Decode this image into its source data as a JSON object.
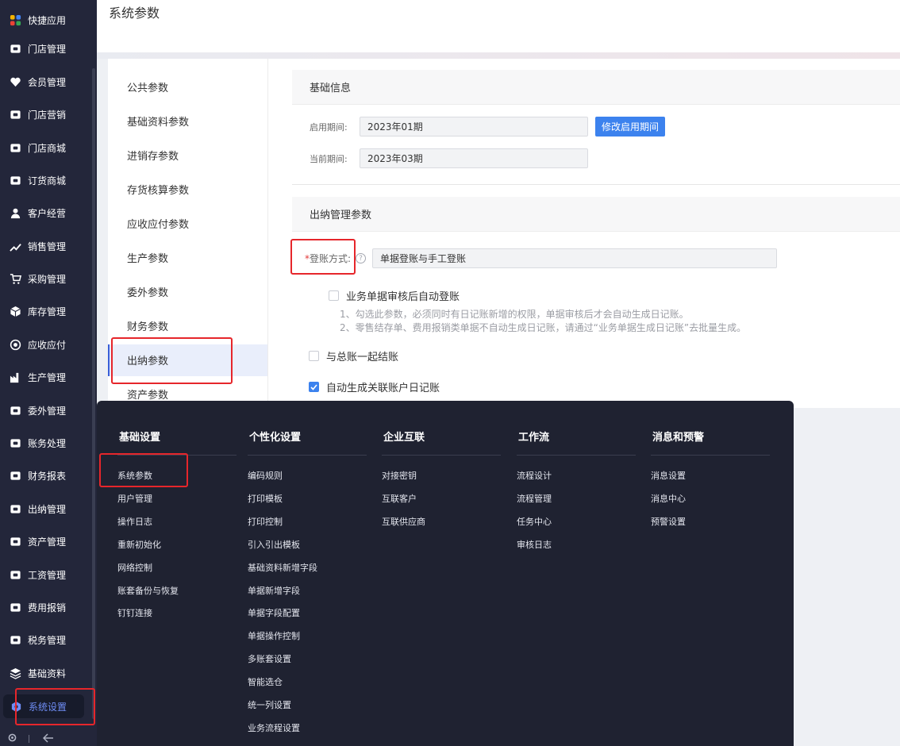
{
  "header": {
    "title": "系统参数"
  },
  "nav": {
    "items": [
      {
        "label": "快捷应用",
        "icon": "grid-apps-icon"
      },
      {
        "label": "门店管理",
        "icon": "store-icon"
      },
      {
        "label": "会员管理",
        "icon": "heart-icon"
      },
      {
        "label": "门店营销",
        "icon": "marketing-icon"
      },
      {
        "label": "门店商城",
        "icon": "mall-icon"
      },
      {
        "label": "订货商城",
        "icon": "bag-icon"
      },
      {
        "label": "客户经营",
        "icon": "user-icon"
      },
      {
        "label": "销售管理",
        "icon": "sales-icon"
      },
      {
        "label": "采购管理",
        "icon": "cart-icon"
      },
      {
        "label": "库存管理",
        "icon": "box-icon"
      },
      {
        "label": "应收应付",
        "icon": "target-icon"
      },
      {
        "label": "生产管理",
        "icon": "factory-icon"
      },
      {
        "label": "委外管理",
        "icon": "outsource-icon"
      },
      {
        "label": "账务处理",
        "icon": "ledger-icon"
      },
      {
        "label": "财务报表",
        "icon": "report-icon"
      },
      {
        "label": "出纳管理",
        "icon": "cashier-icon"
      },
      {
        "label": "资产管理",
        "icon": "asset-icon"
      },
      {
        "label": "工资管理",
        "icon": "salary-icon"
      },
      {
        "label": "费用报销",
        "icon": "expense-icon"
      },
      {
        "label": "税务管理",
        "icon": "tax-icon"
      },
      {
        "label": "基础资料",
        "icon": "layers-icon"
      },
      {
        "label": "系统设置",
        "icon": "settings-hex-icon"
      }
    ],
    "active_index": 21
  },
  "param_list": {
    "items": [
      "公共参数",
      "基础资料参数",
      "进销存参数",
      "存货核算参数",
      "应收应付参数",
      "生产参数",
      "委外参数",
      "财务参数",
      "出纳参数",
      "资产参数"
    ],
    "active_index": 8
  },
  "basic_info": {
    "title": "基础信息",
    "start_period_label": "启用期间:",
    "start_period_value": "2023年01期",
    "modify_button": "修改启用期间",
    "current_period_label": "当前期间:",
    "current_period_value": "2023年03期"
  },
  "cashier": {
    "title": "出纳管理参数",
    "required_mark": "*",
    "posting_label": "登账方式:",
    "help_mark": "?",
    "posting_value": "单据登账与手工登账",
    "auto_post_label": "业务单据审核后自动登账",
    "auto_post_checked": false,
    "note1": "1、勾选此参数，必须同时有日记账新增的权限，单据审核后才会自动生成日记账。",
    "note2": "2、零售结存单、费用报销类单据不自动生成日记账，请通过“业务单据生成日记账”去批量生成。",
    "close_with_gl_label": "与总账一起结账",
    "close_with_gl_checked": false,
    "auto_journal_label": "自动生成关联账户日记账",
    "auto_journal_checked": true
  },
  "megamenu": {
    "columns": [
      {
        "title": "基础设置",
        "items": [
          "系统参数",
          "用户管理",
          "操作日志",
          "重新初始化",
          "网络控制",
          "账套备份与恢复",
          "钉钉连接"
        ]
      },
      {
        "title": "个性化设置",
        "items": [
          "编码规则",
          "打印模板",
          "打印控制",
          "引入引出模板",
          "基础资料新增字段",
          "单据新增字段",
          "单据字段配置",
          "单据操作控制",
          "多账套设置",
          "智能选仓",
          "统一列设置",
          "业务流程设置"
        ]
      },
      {
        "title": "企业互联",
        "items": [
          "对接密钥",
          "互联客户",
          "互联供应商"
        ]
      },
      {
        "title": "工作流",
        "items": [
          "流程设计",
          "流程管理",
          "任务中心",
          "审核日志"
        ]
      },
      {
        "title": "消息和预警",
        "items": [
          "消息设置",
          "消息中心",
          "预警设置"
        ]
      }
    ]
  },
  "colors": {
    "nav_bg": "#23263a",
    "menu_bg": "#1f2231",
    "accent": "#3c82ee",
    "highlight": "#e6262b"
  }
}
